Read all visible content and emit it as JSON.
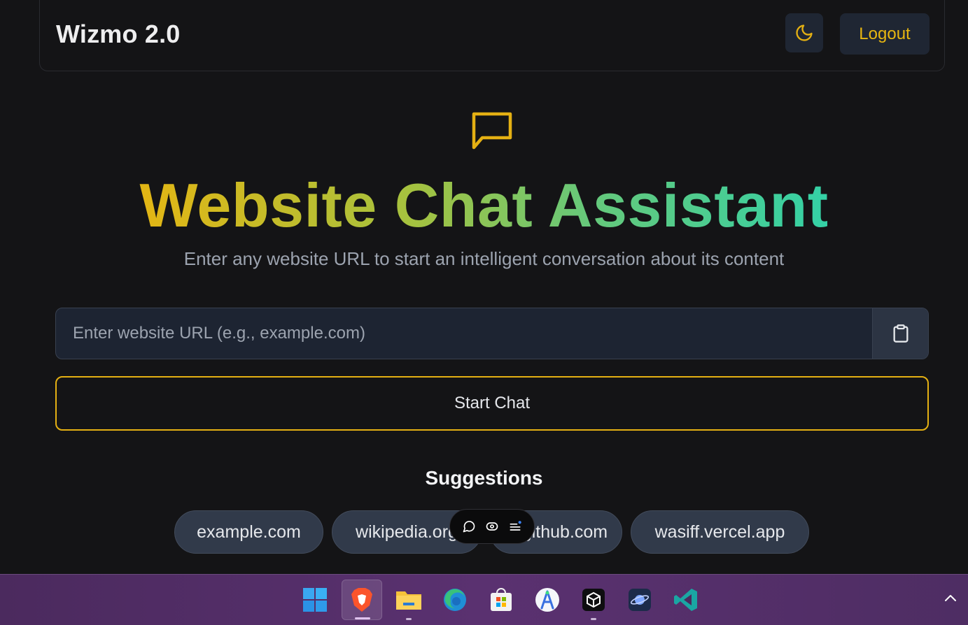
{
  "header": {
    "brand": "Wizmo 2.0",
    "theme_icon": "moon-icon",
    "logout_label": "Logout"
  },
  "hero": {
    "icon": "chat-bubble-icon",
    "title": "Website Chat Assistant",
    "subtitle": "Enter any website URL to start an intelligent conversation about its content"
  },
  "url_form": {
    "placeholder": "Enter website URL (e.g., example.com)",
    "value": "",
    "paste_icon": "clipboard-icon",
    "start_label": "Start Chat"
  },
  "suggestions": {
    "title": "Suggestions",
    "items": [
      "example.com",
      "wikipedia.org",
      "github.com",
      "wasiff.vercel.app"
    ]
  },
  "float_toolbar": {
    "icons": [
      "comment-icon",
      "eye-icon",
      "list-icon"
    ]
  },
  "taskbar": {
    "apps": [
      "windows-start-icon",
      "brave-icon",
      "file-explorer-icon",
      "edge-icon",
      "microsoft-store-icon",
      "android-studio-icon",
      "cube-app-icon",
      "planet-app-icon",
      "vscode-icon"
    ]
  },
  "colors": {
    "accent": "#e4b013",
    "background": "#141416",
    "surface": "#1f2633",
    "taskbar": "#4b2a5e"
  }
}
